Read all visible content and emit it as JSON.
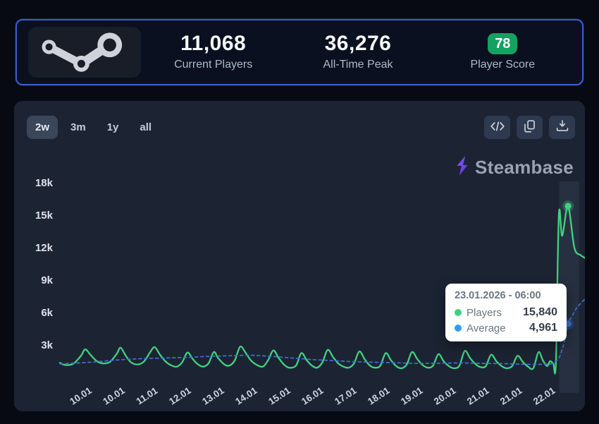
{
  "header": {
    "current_players": "11,068",
    "current_players_label": "Current Players",
    "all_time_peak": "36,276",
    "all_time_peak_label": "All-Time Peak",
    "player_score": "78",
    "player_score_label": "Player Score",
    "score_color": "#15a162"
  },
  "toolbar": {
    "ranges": [
      {
        "label": "2w",
        "active": true
      },
      {
        "label": "3m",
        "active": false
      },
      {
        "label": "1y",
        "active": false
      },
      {
        "label": "all",
        "active": false
      }
    ],
    "icons": [
      "embed-code-icon",
      "copy-icon",
      "download-icon"
    ]
  },
  "brand": {
    "name": "Steambase",
    "glyph_color": "#7a4df3"
  },
  "chart_data": {
    "type": "line",
    "y_ticks": [
      {
        "label": "3k",
        "value": 3000
      },
      {
        "label": "6k",
        "value": 6000
      },
      {
        "label": "9k",
        "value": 9000
      },
      {
        "label": "12k",
        "value": 12000
      },
      {
        "label": "15k",
        "value": 15000
      },
      {
        "label": "18k",
        "value": 18000
      }
    ],
    "ylim": [
      0,
      19000
    ],
    "x_tick_labels": [
      "10.01",
      "10.01",
      "11.01",
      "12.01",
      "13.01",
      "14.01",
      "15.01",
      "16.01",
      "17.01",
      "18.01",
      "19.01",
      "20.01",
      "21.01",
      "21.01",
      "22.01"
    ],
    "grid": false,
    "legend": "none",
    "highlight_band": {
      "x0": 0.947,
      "x1": 0.985
    },
    "series": [
      {
        "name": "Players",
        "color": "#43d17f",
        "style": "solid",
        "points": [
          [
            0.0,
            1350
          ],
          [
            0.01,
            1150
          ],
          [
            0.025,
            1250
          ],
          [
            0.04,
            2000
          ],
          [
            0.048,
            2600
          ],
          [
            0.058,
            2100
          ],
          [
            0.07,
            1500
          ],
          [
            0.082,
            1300
          ],
          [
            0.095,
            1450
          ],
          [
            0.108,
            2200
          ],
          [
            0.115,
            2750
          ],
          [
            0.125,
            2000
          ],
          [
            0.135,
            1400
          ],
          [
            0.148,
            1200
          ],
          [
            0.16,
            1500
          ],
          [
            0.172,
            2400
          ],
          [
            0.18,
            2800
          ],
          [
            0.19,
            2100
          ],
          [
            0.2,
            1500
          ],
          [
            0.212,
            1100
          ],
          [
            0.222,
            1000
          ],
          [
            0.232,
            1400
          ],
          [
            0.242,
            2300
          ],
          [
            0.252,
            1700
          ],
          [
            0.262,
            1200
          ],
          [
            0.272,
            1000
          ],
          [
            0.282,
            1300
          ],
          [
            0.292,
            2350
          ],
          [
            0.3,
            1800
          ],
          [
            0.312,
            1200
          ],
          [
            0.322,
            1100
          ],
          [
            0.332,
            1600
          ],
          [
            0.342,
            2850
          ],
          [
            0.352,
            2300
          ],
          [
            0.362,
            1600
          ],
          [
            0.372,
            1200
          ],
          [
            0.385,
            1000
          ],
          [
            0.395,
            1600
          ],
          [
            0.405,
            2500
          ],
          [
            0.415,
            1800
          ],
          [
            0.425,
            1200
          ],
          [
            0.435,
            900
          ],
          [
            0.448,
            1100
          ],
          [
            0.458,
            2250
          ],
          [
            0.468,
            1600
          ],
          [
            0.478,
            1100
          ],
          [
            0.488,
            900
          ],
          [
            0.498,
            1400
          ],
          [
            0.508,
            2550
          ],
          [
            0.518,
            1900
          ],
          [
            0.528,
            1300
          ],
          [
            0.538,
            1000
          ],
          [
            0.548,
            900
          ],
          [
            0.558,
            1300
          ],
          [
            0.568,
            2400
          ],
          [
            0.578,
            1700
          ],
          [
            0.588,
            1100
          ],
          [
            0.598,
            900
          ],
          [
            0.608,
            1100
          ],
          [
            0.618,
            2250
          ],
          [
            0.628,
            1600
          ],
          [
            0.638,
            1050
          ],
          [
            0.648,
            850
          ],
          [
            0.658,
            1200
          ],
          [
            0.668,
            2350
          ],
          [
            0.678,
            1700
          ],
          [
            0.688,
            1150
          ],
          [
            0.698,
            900
          ],
          [
            0.708,
            1100
          ],
          [
            0.718,
            2150
          ],
          [
            0.728,
            1500
          ],
          [
            0.738,
            1050
          ],
          [
            0.748,
            850
          ],
          [
            0.758,
            1100
          ],
          [
            0.768,
            2450
          ],
          [
            0.778,
            1800
          ],
          [
            0.788,
            1250
          ],
          [
            0.798,
            950
          ],
          [
            0.808,
            1050
          ],
          [
            0.818,
            2100
          ],
          [
            0.828,
            1500
          ],
          [
            0.838,
            1050
          ],
          [
            0.848,
            850
          ],
          [
            0.858,
            1050
          ],
          [
            0.868,
            2000
          ],
          [
            0.878,
            1450
          ],
          [
            0.888,
            1000
          ],
          [
            0.898,
            850
          ],
          [
            0.908,
            2350
          ],
          [
            0.916,
            1600
          ],
          [
            0.924,
            1050
          ],
          [
            0.93,
            1500
          ],
          [
            0.936,
            1300
          ],
          [
            0.941,
            1400
          ],
          [
            0.9465,
            15000
          ],
          [
            0.953,
            13100
          ],
          [
            0.964,
            15840
          ],
          [
            0.976,
            12000
          ],
          [
            0.988,
            11300
          ],
          [
            1.0,
            10950
          ]
        ]
      },
      {
        "name": "Average",
        "color": "#3b72d4",
        "style": "dashed",
        "points": [
          [
            0.0,
            1250
          ],
          [
            0.04,
            1350
          ],
          [
            0.08,
            1500
          ],
          [
            0.12,
            1650
          ],
          [
            0.16,
            1750
          ],
          [
            0.2,
            1800
          ],
          [
            0.24,
            1850
          ],
          [
            0.28,
            1950
          ],
          [
            0.32,
            2000
          ],
          [
            0.36,
            2050
          ],
          [
            0.4,
            1950
          ],
          [
            0.44,
            1800
          ],
          [
            0.48,
            1650
          ],
          [
            0.52,
            1550
          ],
          [
            0.56,
            1450
          ],
          [
            0.6,
            1400
          ],
          [
            0.64,
            1350
          ],
          [
            0.68,
            1300
          ],
          [
            0.72,
            1320
          ],
          [
            0.76,
            1340
          ],
          [
            0.8,
            1300
          ],
          [
            0.84,
            1280
          ],
          [
            0.87,
            1230
          ],
          [
            0.9,
            1200
          ],
          [
            0.92,
            1230
          ],
          [
            0.935,
            1300
          ],
          [
            0.9465,
            1800
          ],
          [
            0.953,
            2600
          ],
          [
            0.958,
            3500
          ],
          [
            0.964,
            4961
          ],
          [
            0.972,
            5700
          ],
          [
            0.98,
            6400
          ],
          [
            0.99,
            6950
          ],
          [
            1.0,
            7400
          ]
        ]
      }
    ],
    "markers": [
      {
        "series": "Players",
        "x": 0.964,
        "value": 15840
      },
      {
        "series": "Average",
        "x": 0.964,
        "value": 4961
      }
    ],
    "tooltip": {
      "header": "23.01.2026 - 06:00",
      "rows": [
        {
          "label": "Players",
          "value": "15,840",
          "color": "#3ed17c"
        },
        {
          "label": "Average",
          "value": "4,961",
          "color": "#2b9ff5"
        }
      ]
    }
  }
}
